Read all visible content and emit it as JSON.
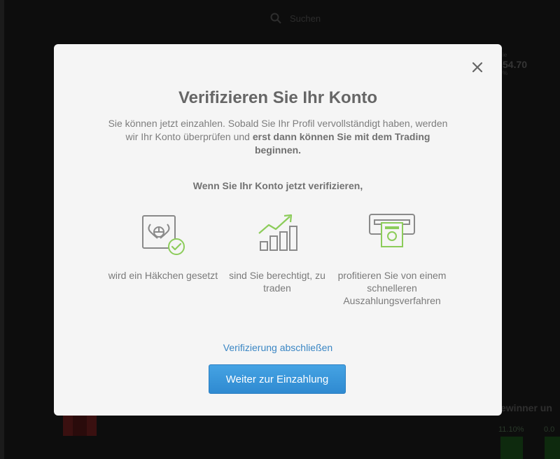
{
  "background": {
    "search_placeholder": "Suchen",
    "ticker": {
      "label": "ie",
      "price": "54.70",
      "change": "%"
    },
    "section_title": "ewinner un",
    "stats": [
      "11.10%",
      "0.0"
    ]
  },
  "modal": {
    "title": "Verifizieren Sie Ihr Konto",
    "intro_text": "Sie können jetzt einzahlen. Sobald Sie Ihr Profil vervollständigt haben, werden wir Ihr Konto überprüfen und ",
    "intro_bold": "erst dann können Sie mit dem Trading beginnen.",
    "subheading": "Wenn Sie Ihr Konto jetzt verifizieren,",
    "benefits": [
      {
        "icon": "verified-checkmark-icon",
        "caption": "wird ein Häkchen gesetzt"
      },
      {
        "icon": "growth-chart-icon",
        "caption": "sind Sie berechtigt, zu traden"
      },
      {
        "icon": "cash-withdrawal-icon",
        "caption": "profitieren Sie von einem schnelleren Auszahlungsverfahren"
      }
    ],
    "complete_link": "Verifizierung abschließen",
    "continue_button": "Weiter zur Einzahlung",
    "close_icon": "close-icon"
  },
  "colors": {
    "accent_blue": "#3a86c4",
    "button_blue": "#3a97dc",
    "green_check": "#8ccc5a",
    "overlay": "#121212"
  }
}
